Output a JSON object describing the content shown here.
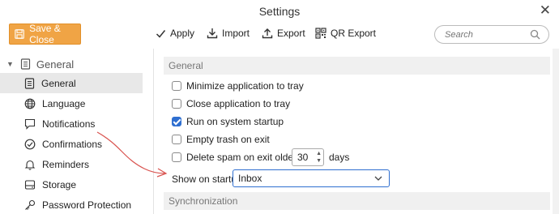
{
  "window": {
    "title": "Settings",
    "close_glyph": "✕"
  },
  "toolbar": {
    "save_close": "Save & Close",
    "apply": "Apply",
    "import": "Import",
    "export": "Export",
    "qr_export": "QR Export",
    "search_placeholder": "Search",
    "accent_color": "#f0a445"
  },
  "sidebar": {
    "group": "General",
    "items": [
      {
        "label": "General",
        "icon": "document-icon",
        "active": true
      },
      {
        "label": "Language",
        "icon": "globe-icon"
      },
      {
        "label": "Notifications",
        "icon": "speech-bubble-icon"
      },
      {
        "label": "Confirmations",
        "icon": "check-circle-icon"
      },
      {
        "label": "Reminders",
        "icon": "bell-icon"
      },
      {
        "label": "Storage",
        "icon": "storage-icon"
      },
      {
        "label": "Password Protection",
        "icon": "key-icon"
      }
    ]
  },
  "content": {
    "section_general": "General",
    "options": [
      {
        "label": "Minimize application to tray",
        "checked": false
      },
      {
        "label": "Close application to tray",
        "checked": false
      },
      {
        "label": "Run on system startup",
        "checked": true
      },
      {
        "label": "Empty trash on exit",
        "checked": false
      },
      {
        "label": "Delete spam on exit older than",
        "checked": false
      }
    ],
    "spam_days_value": "30",
    "days_label": "days",
    "show_on_startup_label": "Show on startup:",
    "show_on_startup_value": "Inbox",
    "section_sync": "Synchronization"
  }
}
